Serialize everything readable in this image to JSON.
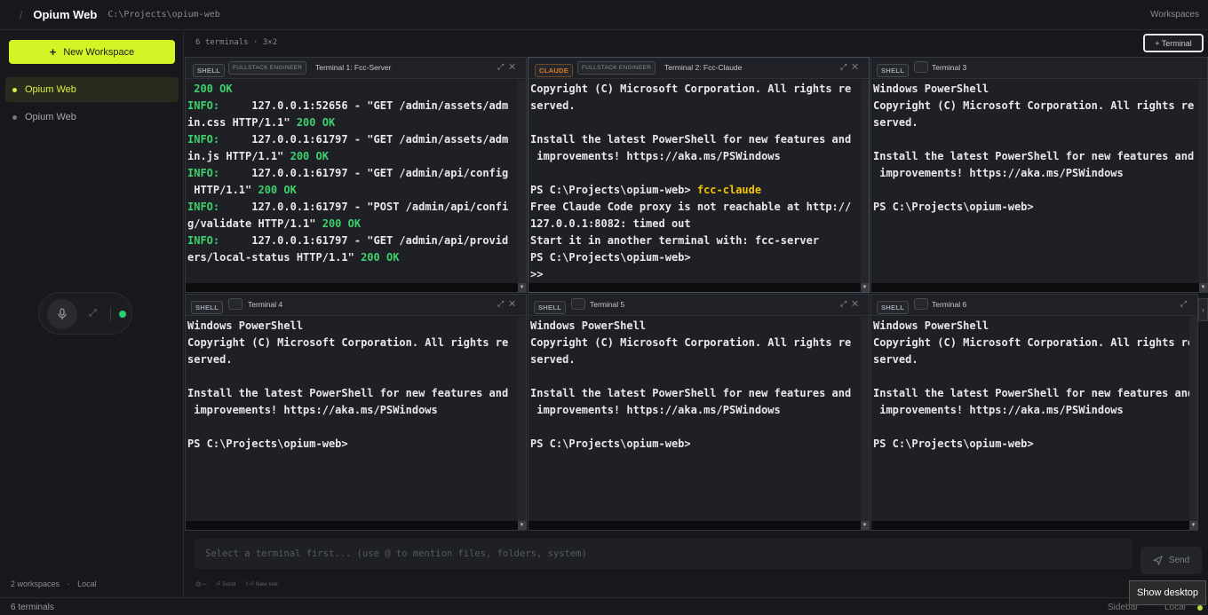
{
  "app": {
    "title": "Opium Web",
    "path": "C:\\Projects\\opium-web",
    "workspaces_label": "Workspaces"
  },
  "sidebar": {
    "new_workspace": "New Workspace",
    "items": [
      {
        "label": "Opium Web",
        "active": true
      },
      {
        "label": "Opium Web",
        "active": false
      }
    ],
    "footer_count": "2 workspaces",
    "footer_sep": "·",
    "footer_mode": "Local"
  },
  "main": {
    "count": "6 terminals · 3×2",
    "add_terminal": "+ Terminal"
  },
  "panels": [
    {
      "kind": "SHELL",
      "role": "FULLSTACK ENGINEER",
      "name": "Terminal 1: Fcc-Server",
      "lines": [
        [
          {
            "t": " 200 OK",
            "c": "g"
          }
        ],
        [
          {
            "t": "INFO:",
            "c": "g"
          },
          {
            "t": "     127.0.0.1:52656 - \"GET /admin/assets/adm"
          }
        ],
        [
          {
            "t": "in.css HTTP/1.1\" "
          },
          {
            "t": "200 OK",
            "c": "g"
          }
        ],
        [
          {
            "t": "INFO:",
            "c": "g"
          },
          {
            "t": "     127.0.0.1:61797 - \"GET /admin/assets/adm"
          }
        ],
        [
          {
            "t": "in.js HTTP/1.1\" "
          },
          {
            "t": "200 OK",
            "c": "g"
          }
        ],
        [
          {
            "t": "INFO:",
            "c": "g"
          },
          {
            "t": "     127.0.0.1:61797 - \"GET /admin/api/config"
          }
        ],
        [
          {
            "t": " HTTP/1.1\" "
          },
          {
            "t": "200 OK",
            "c": "g"
          }
        ],
        [
          {
            "t": "INFO:",
            "c": "g"
          },
          {
            "t": "     127.0.0.1:61797 - \"POST /admin/api/confi"
          }
        ],
        [
          {
            "t": "g/validate HTTP/1.1\" "
          },
          {
            "t": "200 OK",
            "c": "g"
          }
        ],
        [
          {
            "t": "INFO:",
            "c": "g"
          },
          {
            "t": "     127.0.0.1:61797 - \"GET /admin/api/provid"
          }
        ],
        [
          {
            "t": "ers/local-status HTTP/1.1\" "
          },
          {
            "t": "200 OK",
            "c": "g"
          }
        ]
      ]
    },
    {
      "kind": "CLAUDE",
      "role": "FULLSTACK ENGINEER",
      "name": "Terminal 2: Fcc-Claude",
      "lines": [
        [
          {
            "t": "Copyright (C) Microsoft Corporation. All rights re"
          }
        ],
        [
          {
            "t": "served."
          }
        ],
        [
          {
            "t": ""
          }
        ],
        [
          {
            "t": "Install the latest PowerShell for new features and"
          }
        ],
        [
          {
            "t": " improvements! https://aka.ms/PSWindows"
          }
        ],
        [
          {
            "t": ""
          }
        ],
        [
          {
            "t": "PS C:\\Projects\\opium-web> "
          },
          {
            "t": "fcc-claude",
            "c": "y"
          }
        ],
        [
          {
            "t": "Free Claude Code proxy is not reachable at http://"
          }
        ],
        [
          {
            "t": "127.0.0.1:8082: timed out"
          }
        ],
        [
          {
            "t": "Start it in another terminal with: fcc-server"
          }
        ],
        [
          {
            "t": "PS C:\\Projects\\opium-web>"
          }
        ],
        [
          {
            "t": ">>"
          }
        ]
      ]
    },
    {
      "kind": "SHELL",
      "role": "",
      "name": "Terminal 3",
      "lines": [
        [
          {
            "t": "Windows PowerShell"
          }
        ],
        [
          {
            "t": "Copyright (C) Microsoft Corporation. All rights re"
          }
        ],
        [
          {
            "t": "served."
          }
        ],
        [
          {
            "t": ""
          }
        ],
        [
          {
            "t": "Install the latest PowerShell for new features and"
          }
        ],
        [
          {
            "t": " improvements! https://aka.ms/PSWindows"
          }
        ],
        [
          {
            "t": ""
          }
        ],
        [
          {
            "t": "PS C:\\Projects\\opium-web>"
          }
        ]
      ]
    },
    {
      "kind": "SHELL",
      "role": "",
      "name": "Terminal 4",
      "lines": [
        [
          {
            "t": "Windows PowerShell"
          }
        ],
        [
          {
            "t": "Copyright (C) Microsoft Corporation. All rights re"
          }
        ],
        [
          {
            "t": "served."
          }
        ],
        [
          {
            "t": ""
          }
        ],
        [
          {
            "t": "Install the latest PowerShell for new features and"
          }
        ],
        [
          {
            "t": " improvements! https://aka.ms/PSWindows"
          }
        ],
        [
          {
            "t": ""
          }
        ],
        [
          {
            "t": "PS C:\\Projects\\opium-web>"
          }
        ]
      ]
    },
    {
      "kind": "SHELL",
      "role": "",
      "name": "Terminal 5",
      "lines": [
        [
          {
            "t": "Windows PowerShell"
          }
        ],
        [
          {
            "t": "Copyright (C) Microsoft Corporation. All rights re"
          }
        ],
        [
          {
            "t": "served."
          }
        ],
        [
          {
            "t": ""
          }
        ],
        [
          {
            "t": "Install the latest PowerShell for new features and"
          }
        ],
        [
          {
            "t": " improvements! https://aka.ms/PSWindows"
          }
        ],
        [
          {
            "t": ""
          }
        ],
        [
          {
            "t": "PS C:\\Projects\\opium-web>"
          }
        ]
      ]
    },
    {
      "kind": "SHELL",
      "role": "",
      "name": "Terminal 6",
      "lines": [
        [
          {
            "t": "Windows PowerShell"
          }
        ],
        [
          {
            "t": "Copyright (C) Microsoft Corporation. All rights re"
          }
        ],
        [
          {
            "t": "served."
          }
        ],
        [
          {
            "t": ""
          }
        ],
        [
          {
            "t": "Install the latest PowerShell for new features and"
          }
        ],
        [
          {
            "t": " improvements! https://aka.ms/PSWindows"
          }
        ],
        [
          {
            "t": ""
          }
        ],
        [
          {
            "t": "PS C:\\Projects\\opium-web>"
          }
        ]
      ]
    }
  ],
  "input": {
    "placeholder": "Select a terminal first... (use @ to mention files, folders, system)",
    "hint1": "@—",
    "hint2": "⏎ Send",
    "hint3": "⇧⏎ New line",
    "send": "Send"
  },
  "status": {
    "terminals": "6 terminals",
    "sidebar": "Sidebar",
    "local": "Local"
  },
  "tooltip": "Show desktop",
  "colors": {
    "accent": "#d4f525",
    "ok_green": "#3cd16b",
    "cmd_yellow": "#f5c400",
    "claude_orange": "#e07a1f"
  }
}
